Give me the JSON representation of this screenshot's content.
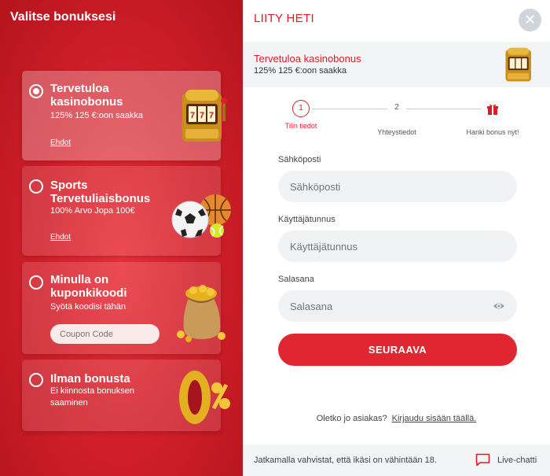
{
  "left": {
    "title": "Valitse bonuksesi",
    "cards": [
      {
        "title": "Tervetuloa kasinobonus",
        "sub": "125% 125 €:oon saakka",
        "link": "Ehdot",
        "selected": true
      },
      {
        "title": "Sports Tervetuliaisbonus",
        "sub": "100% Arvo Jopa 100€",
        "link": "Ehdot",
        "selected": false
      },
      {
        "title": "Minulla on kuponkikoodi",
        "sub": "Syötä koodisi tähän",
        "placeholder": "Coupon Code",
        "selected": false
      },
      {
        "title": "Ilman bonusta",
        "sub": "Ei kiinnosta bonuksen saaminen",
        "selected": false
      }
    ]
  },
  "right": {
    "title": "LIITY HETI",
    "bonus": {
      "title": "Tervetuloa kasinobonus",
      "sub": "125% 125 €:oon saakka"
    },
    "steps": [
      {
        "num": "1",
        "label": "Tilin tiedot"
      },
      {
        "num": "2",
        "label": "Yhteystiedot"
      },
      {
        "label": "Hanki bonus nyt!"
      }
    ],
    "fields": [
      {
        "label": "Sähköposti",
        "placeholder": "Sähköposti"
      },
      {
        "label": "Käyttäjätunnus",
        "placeholder": "Käyttäjätunnus"
      },
      {
        "label": "Salasana",
        "placeholder": "Salasana"
      }
    ],
    "submit": "SEURAAVA",
    "login_prompt": "Oletko jo asiakas?",
    "login_link": "Kirjaudu sisään täällä.",
    "footer_text": "Jatkamalla vahvistat, että ikäsi on vähintään 18.",
    "chat_label": "Live-chatti"
  },
  "colors": {
    "brand_red": "#d81e28",
    "button_red": "#e02630"
  }
}
